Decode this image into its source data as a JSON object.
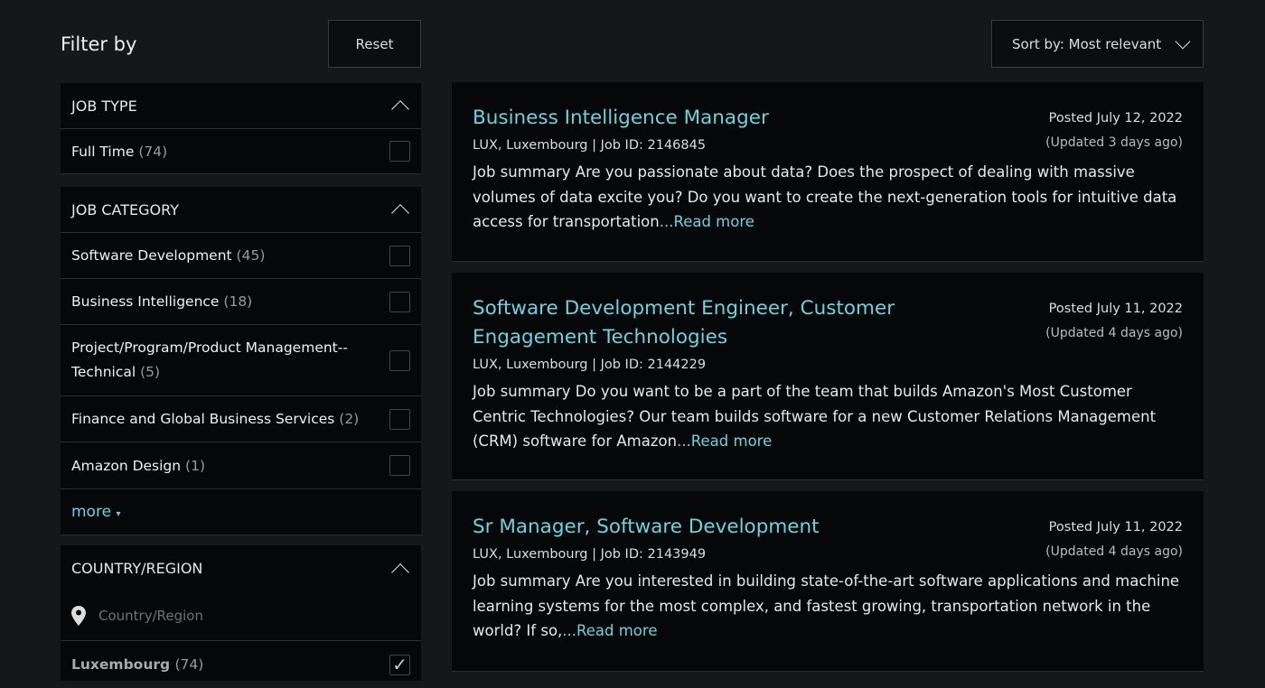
{
  "filter": {
    "title": "Filter by",
    "reset": "Reset"
  },
  "sort": {
    "label": "Sort by: Most relevant"
  },
  "job_type": {
    "title": "JOB TYPE",
    "items": [
      {
        "label": "Full Time",
        "count": "(74)"
      }
    ]
  },
  "job_category": {
    "title": "JOB CATEGORY",
    "items": [
      {
        "label": "Software Development",
        "count": "(45)"
      },
      {
        "label": "Business Intelligence",
        "count": "(18)"
      },
      {
        "label": "Project/Program/Product Management--Technical",
        "count": "(5)"
      },
      {
        "label": "Finance and Global Business Services",
        "count": "(2)"
      },
      {
        "label": "Amazon Design",
        "count": "(1)"
      }
    ],
    "more": "more"
  },
  "country": {
    "title": "COUNTRY/REGION",
    "placeholder": "Country/Region",
    "items": [
      {
        "label": "Luxembourg",
        "count": "(74)",
        "checked": true
      }
    ]
  },
  "jobs": [
    {
      "title": "Business Intelligence Manager",
      "meta": "LUX, Luxembourg | Job ID: 2146845",
      "posted": "Posted July 12, 2022",
      "updated": "(Updated 3 days ago)",
      "summary": "Job summary Are you passionate about data? Does the prospect of dealing with massive volumes of data excite you? Do you want to create the next-generation tools for intuitive data access for transportation",
      "read_more": "...Read more"
    },
    {
      "title": "Software Development Engineer, Customer Engagement Technologies",
      "meta": "LUX, Luxembourg | Job ID: 2144229",
      "posted": "Posted July 11, 2022",
      "updated": "(Updated 4 days ago)",
      "summary": "Job summary Do you want to be a part of the team that builds Amazon's Most Customer Centric Technologies? Our team builds software for a new Customer Relations Management (CRM) software for Amazon",
      "read_more": "...Read more"
    },
    {
      "title": "Sr Manager, Software Development",
      "meta": "LUX, Luxembourg | Job ID: 2143949",
      "posted": "Posted July 11, 2022",
      "updated": "(Updated 4 days ago)",
      "summary": "Job summary Are you interested in building state-of-the-art software applications and machine learning systems for the most complex, and fastest growing, transportation network in the world? If so,",
      "read_more": "...Read more"
    }
  ]
}
